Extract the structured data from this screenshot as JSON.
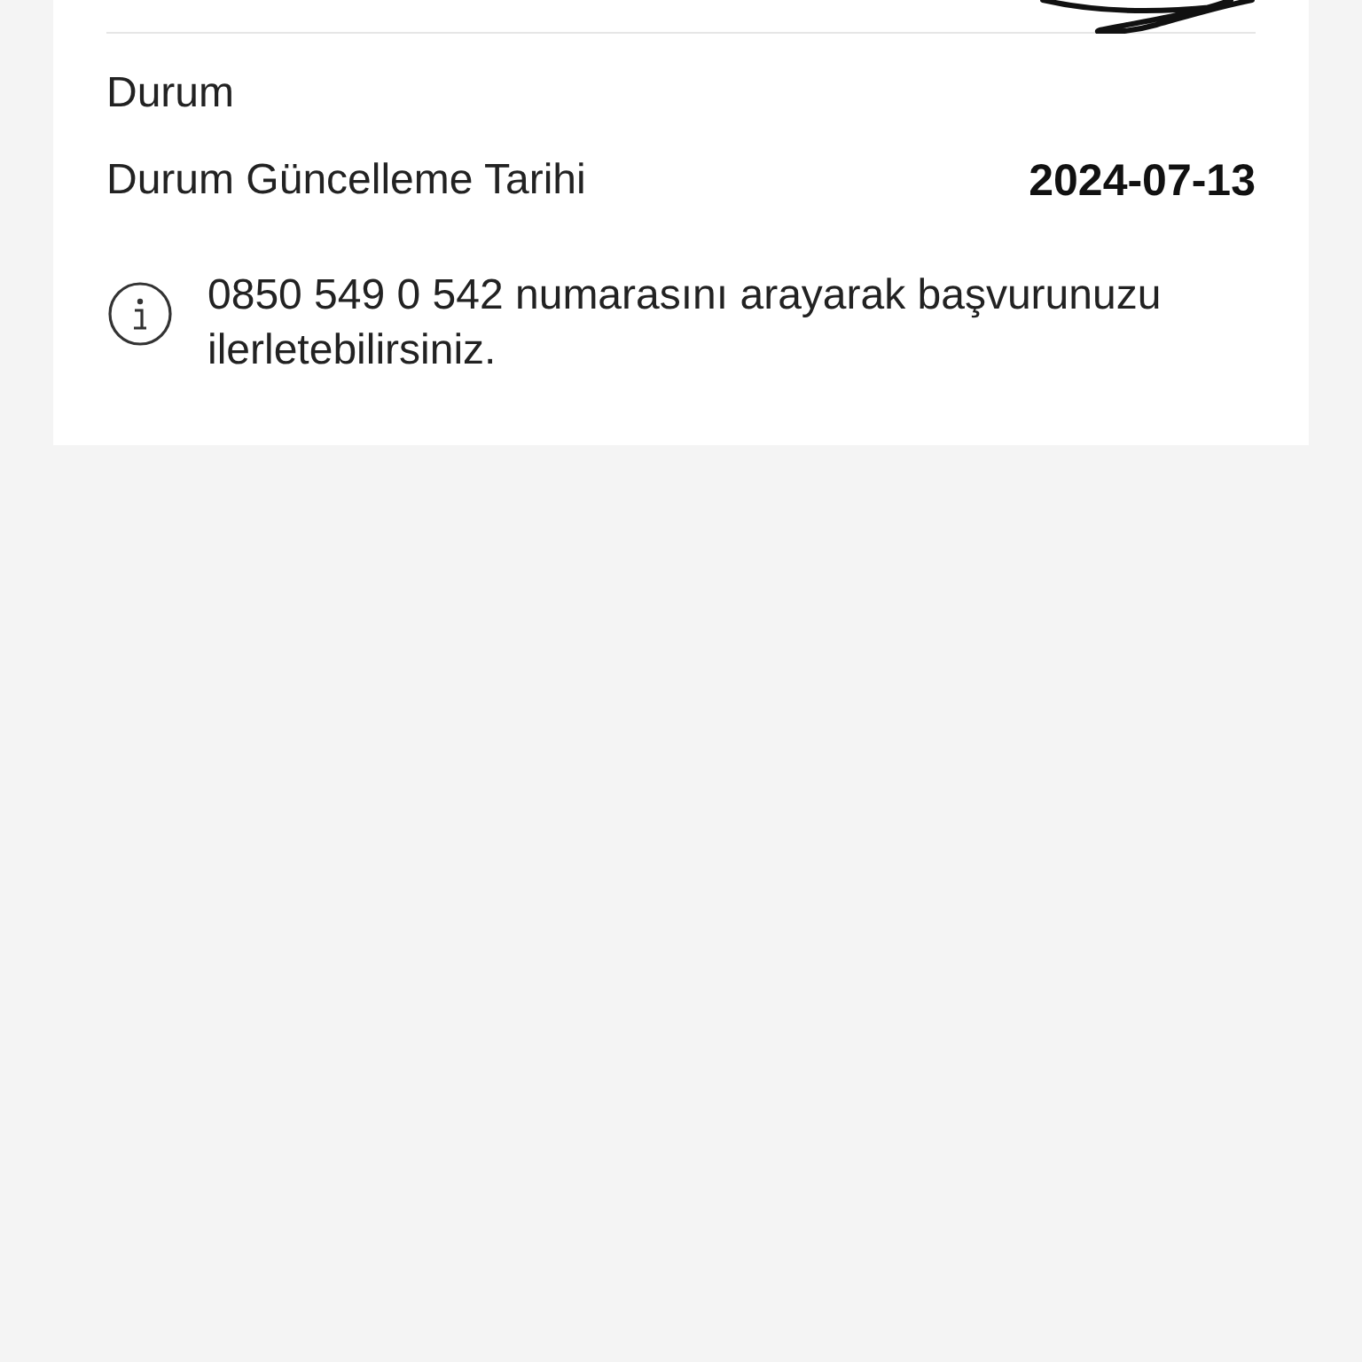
{
  "card": {
    "status_label": "Durum",
    "fields": [
      {
        "label": "Durum Güncelleme Tarihi",
        "value": "2024-07-13"
      }
    ],
    "info": "0850 549 0 542 numarasını arayarak başvurunuzu ilerletebilirsiniz."
  }
}
